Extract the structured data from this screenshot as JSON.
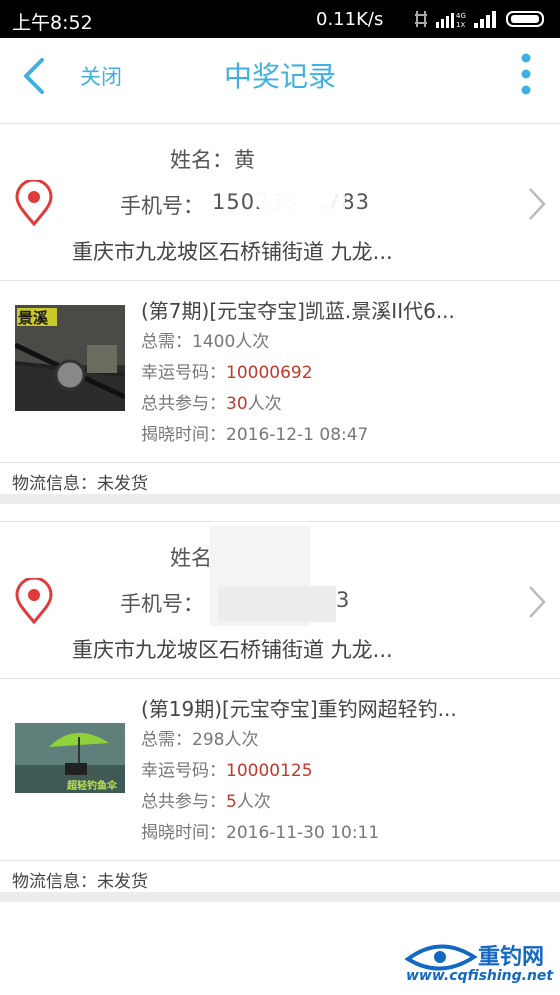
{
  "status": {
    "time": "上午8:52",
    "speed": "0.11K/s",
    "network": "4G 1X"
  },
  "nav": {
    "close_label": "关闭",
    "title": "中奖记录"
  },
  "records": [
    {
      "name_label": "姓名：",
      "name_value": "黄",
      "phone_label": "手机号：",
      "phone_value": "15023394783",
      "address": "重庆市九龙坡区石桥铺街道 九龙...",
      "product_title": "(第7期)[元宝夺宝]凯蓝.景溪II代6...",
      "total_label": "总需：",
      "total_value": "1400人次",
      "lucky_label": "幸运号码：",
      "lucky_value": "10000692",
      "join_label": "总共参与：",
      "join_count": "30",
      "join_unit": "人次",
      "reveal_label": "揭晓时间：",
      "reveal_time": "2016-12-1 08:47",
      "logistics": "物流信息：未发货",
      "thumb_text": "景溪"
    },
    {
      "name_label": "姓名",
      "name_value": "",
      "phone_label": "手机号：",
      "phone_value": "3",
      "address": "重庆市九龙坡区石桥铺街道 九龙...",
      "product_title": "(第19期)[元宝夺宝]重钓网超轻钓...",
      "total_label": "总需：",
      "total_value": "298人次",
      "lucky_label": "幸运号码：",
      "lucky_value": "10000125",
      "join_label": "总共参与：",
      "join_count": "5",
      "join_unit": "人次",
      "reveal_label": "揭晓时间：",
      "reveal_time": "2016-11-30 10:11",
      "logistics": "物流信息：未发货",
      "thumb_text": "超轻钓鱼伞"
    }
  ],
  "watermark": {
    "brand": "重钓网",
    "url": "www.cqfishing.net"
  },
  "colors": {
    "accent": "#3fb1e0",
    "pin": "#e03a3a",
    "lucky_red": "#c0392b"
  }
}
